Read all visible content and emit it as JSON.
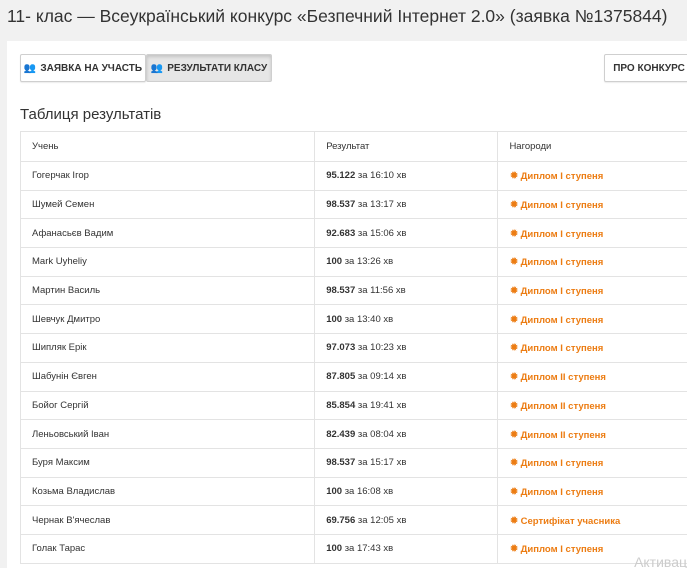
{
  "header": {
    "title": "11- клас — Всеукраїнський конкурс «Безпечний Інтернет 2.0» (заявка №1375844)"
  },
  "toolbar": {
    "apply_label": "ЗАЯВКА НА УЧАСТЬ",
    "results_label": "РЕЗУЛЬТАТИ КЛАСУ",
    "about_label": "ПРО КОНКУРС"
  },
  "results": {
    "title": "Таблиця результатів",
    "columns": [
      "Учень",
      "Результат",
      "Нагороди"
    ],
    "rows": [
      {
        "student": "Гогерчак Ігор",
        "score": "95.122",
        "time": "за 16:10 хв",
        "award": "Диплом I ступеня"
      },
      {
        "student": "Шумей Семен",
        "score": "98.537",
        "time": "за 13:17 хв",
        "award": "Диплом I ступеня"
      },
      {
        "student": "Афанасьєв Вадим",
        "score": "92.683",
        "time": "за 15:06 хв",
        "award": "Диплом I ступеня"
      },
      {
        "student": "Mark Uyheliy",
        "score": "100",
        "time": "за 13:26 хв",
        "award": "Диплом I ступеня"
      },
      {
        "student": "Мартин Василь",
        "score": "98.537",
        "time": "за 11:56 хв",
        "award": "Диплом I ступеня"
      },
      {
        "student": "Шевчук Дмитро",
        "score": "100",
        "time": "за 13:40 хв",
        "award": "Диплом I ступеня"
      },
      {
        "student": "Шипляк Ерік",
        "score": "97.073",
        "time": "за 10:23 хв",
        "award": "Диплом I ступеня"
      },
      {
        "student": "Шабунін Євген",
        "score": "87.805",
        "time": "за 09:14 хв",
        "award": "Диплом II ступеня"
      },
      {
        "student": "Бойог Сергій",
        "score": "85.854",
        "time": "за 19:41 хв",
        "award": "Диплом II ступеня"
      },
      {
        "student": "Леньовський Іван",
        "score": "82.439",
        "time": "за 08:04 хв",
        "award": "Диплом II ступеня"
      },
      {
        "student": "Буря Максим",
        "score": "98.537",
        "time": "за 15:17 хв",
        "award": "Диплом I ступеня"
      },
      {
        "student": "Козьма Владислав",
        "score": "100",
        "time": "за 16:08 хв",
        "award": "Диплом I ступеня"
      },
      {
        "student": "Чернак В'ячеслав",
        "score": "69.756",
        "time": "за 12:05 хв",
        "award": "Сертифікат учасника"
      },
      {
        "student": "Голак Тарас",
        "score": "100",
        "time": "за 17:43 хв",
        "award": "Диплом I ступеня"
      }
    ]
  },
  "colors": {
    "award": "#ec7c12",
    "icon": "#f0a030"
  },
  "icons": {
    "apply": "users-icon",
    "results": "users-icon",
    "award": "sun-icon"
  },
  "watermark": "Активац"
}
